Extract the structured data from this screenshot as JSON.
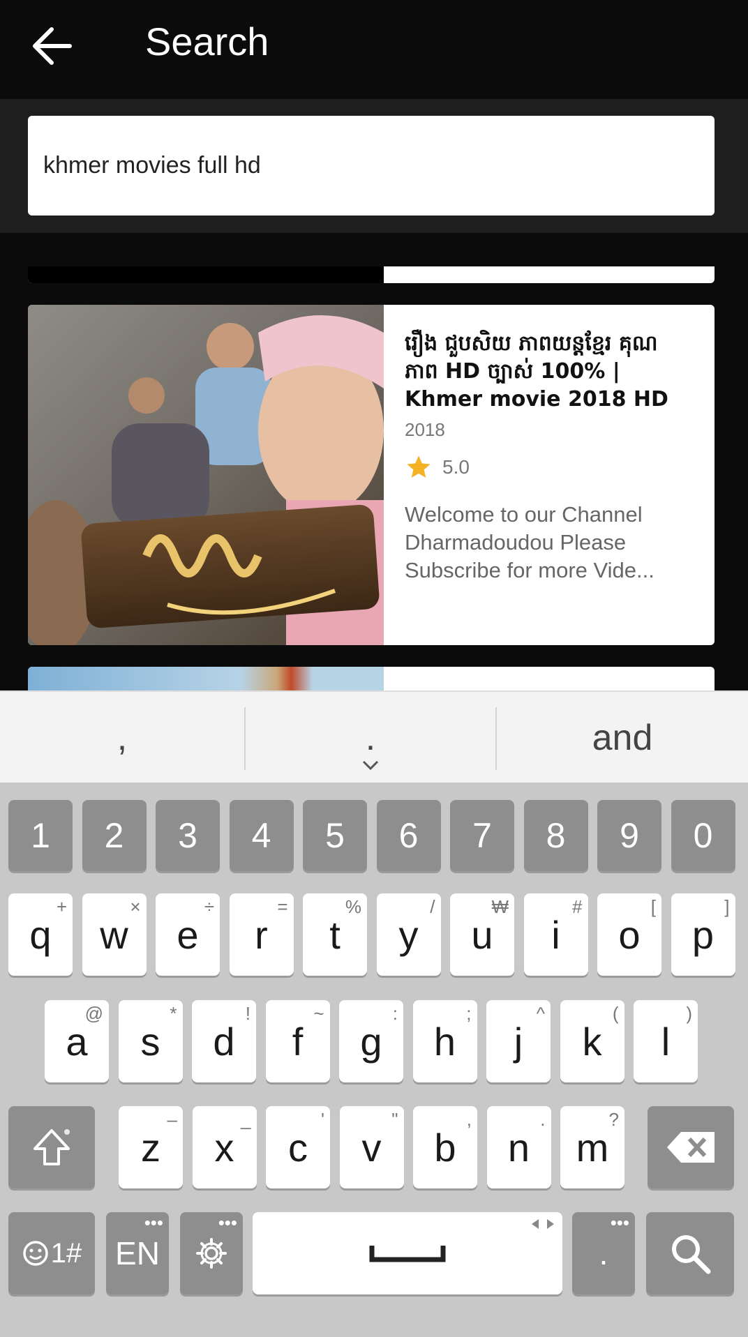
{
  "appbar": {
    "title": "Search"
  },
  "search": {
    "value": "khmer movies full hd"
  },
  "result": {
    "title": "រឿង ជួបសិយ ភាពយន្តខ្មែរ គុណភាព HD ច្បាស់ 100% | Khmer movie 2018 HD",
    "year": "2018",
    "rating": "5.0",
    "description": "Welcome to our Channel Dharmadoudou Please Subscribe for more Vide..."
  },
  "keyboard": {
    "suggestions": [
      ",",
      ".",
      "and"
    ],
    "numbers": [
      "1",
      "2",
      "3",
      "4",
      "5",
      "6",
      "7",
      "8",
      "9",
      "0"
    ],
    "row1": [
      {
        "k": "q",
        "h": "+"
      },
      {
        "k": "w",
        "h": "×"
      },
      {
        "k": "e",
        "h": "÷"
      },
      {
        "k": "r",
        "h": "="
      },
      {
        "k": "t",
        "h": "%"
      },
      {
        "k": "y",
        "h": "/"
      },
      {
        "k": "u",
        "h": "₩"
      },
      {
        "k": "i",
        "h": "#"
      },
      {
        "k": "o",
        "h": "["
      },
      {
        "k": "p",
        "h": "]"
      }
    ],
    "row2": [
      {
        "k": "a",
        "h": "@"
      },
      {
        "k": "s",
        "h": "*"
      },
      {
        "k": "d",
        "h": "!"
      },
      {
        "k": "f",
        "h": "~"
      },
      {
        "k": "g",
        "h": ":"
      },
      {
        "k": "h",
        "h": ";"
      },
      {
        "k": "j",
        "h": "^"
      },
      {
        "k": "k",
        "h": "("
      },
      {
        "k": "l",
        "h": ")"
      }
    ],
    "row3": [
      {
        "k": "z",
        "h": "–"
      },
      {
        "k": "x",
        "h": "_"
      },
      {
        "k": "c",
        "h": "'"
      },
      {
        "k": "v",
        "h": "\""
      },
      {
        "k": "b",
        "h": ","
      },
      {
        "k": "n",
        "h": "."
      },
      {
        "k": "m",
        "h": "?"
      }
    ],
    "symbols_label": "1#",
    "lang_label": "EN",
    "period_label": "."
  }
}
